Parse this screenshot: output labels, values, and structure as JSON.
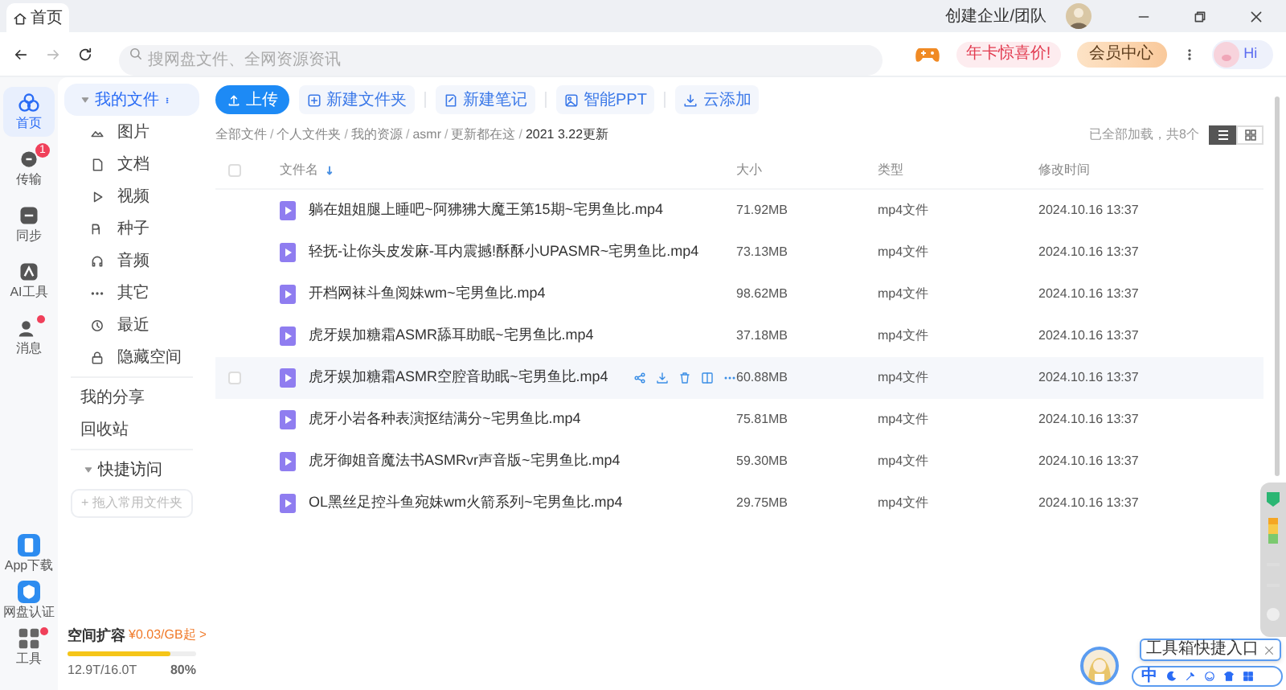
{
  "tab": {
    "label": "首页",
    "selected": true
  },
  "title_bar": {
    "team_link": "创建企业/团队"
  },
  "nav": {
    "search": {
      "placeholder": "搜网盘文件、全网资源资讯"
    },
    "promo": "年卡惊喜价!",
    "vip_button": "会员中心",
    "greeting": "Hi"
  },
  "rail": {
    "top": [
      {
        "label": "首页",
        "selected": true,
        "dot": false
      },
      {
        "label": "传输",
        "selected": false,
        "badge": "1",
        "dot": false
      },
      {
        "label": "同步",
        "selected": false,
        "dot": false
      },
      {
        "label": "AI工具",
        "selected": false,
        "dot": false
      },
      {
        "label": "消息",
        "selected": false,
        "dot": true
      }
    ],
    "bottom": [
      {
        "label": "App下载",
        "dot": false
      },
      {
        "label": "网盘认证",
        "dot": false
      },
      {
        "label": "工具",
        "dot": true
      }
    ]
  },
  "sidebar": {
    "my_files": {
      "label": "我的文件",
      "expanded": true,
      "selected": true,
      "children": [
        {
          "label": "图片"
        },
        {
          "label": "文档"
        },
        {
          "label": "视频"
        },
        {
          "label": "种子"
        },
        {
          "label": "音频"
        },
        {
          "label": "其它"
        }
      ]
    },
    "items": [
      {
        "label": "最近",
        "kind": "icon"
      },
      {
        "label": "隐藏空间",
        "kind": "icon"
      },
      {
        "label": "我的分享",
        "kind": "plain"
      },
      {
        "label": "回收站",
        "kind": "plain"
      }
    ],
    "quick_access": {
      "label": "快捷访问",
      "expanded": true,
      "drop_hint": "+ 拖入常用文件夹"
    },
    "storage": {
      "title": "空间扩容",
      "offer": "¥0.03/GB起 >",
      "level": 0.8,
      "usage": "12.9T/16.0T",
      "percent": "80%"
    }
  },
  "toolbar": {
    "upload": "上传",
    "actions": [
      "新建文件夹",
      "新建笔记",
      "智能PPT",
      "云添加"
    ]
  },
  "breadcrumb": {
    "separator": "/",
    "items": [
      "全部文件",
      "个人文件夹",
      "我的资源",
      "asmr",
      "更新都在这",
      "2021 3.22更新"
    ]
  },
  "status": "已全部加载，共8个",
  "view_mode": {
    "list_selected": true
  },
  "table": {
    "select_all": {
      "checked": false
    },
    "columns": [
      "文件名",
      "大小",
      "类型",
      "修改时间"
    ],
    "rows": [
      {
        "name": "躺在姐姐腿上睡吧~阿狒狒大魔王第15期~宅男鱼比.mp4",
        "size": "71.92MB",
        "type": "mp4文件",
        "time": "2024.10.16 13:37",
        "selected": false
      },
      {
        "name": "轻抚-让你头皮发麻-耳内震撼!酥酥小UPASMR~宅男鱼比.mp4",
        "size": "73.13MB",
        "type": "mp4文件",
        "time": "2024.10.16 13:37",
        "selected": false
      },
      {
        "name": "开档网袜斗鱼阅妹wm~宅男鱼比.mp4",
        "size": "98.62MB",
        "type": "mp4文件",
        "time": "2024.10.16 13:37",
        "selected": false
      },
      {
        "name": "虎牙娱加糖霜ASMR舔耳助眠~宅男鱼比.mp4",
        "size": "37.18MB",
        "type": "mp4文件",
        "time": "2024.10.16 13:37",
        "selected": false
      },
      {
        "name": "虎牙娱加糖霜ASMR空腔音助眠~宅男鱼比.mp4",
        "size": "60.88MB",
        "type": "mp4文件",
        "time": "2024.10.16 13:37",
        "selected": true
      },
      {
        "name": "虎牙小岩各种表演抠结满分~宅男鱼比.mp4",
        "size": "75.81MB",
        "type": "mp4文件",
        "time": "2024.10.16 13:37",
        "selected": false
      },
      {
        "name": "虎牙御姐音魔法书ASMRvr声音版~宅男鱼比.mp4",
        "size": "59.30MB",
        "type": "mp4文件",
        "time": "2024.10.16 13:37",
        "selected": false
      },
      {
        "name": "OL黑丝足控斗鱼宛妹wm火箭系列~宅男鱼比.mp4",
        "size": "29.75MB",
        "type": "mp4文件",
        "time": "2024.10.16 13:37",
        "selected": false
      }
    ]
  },
  "assistant": {
    "tooltip": "工具箱快捷入口",
    "ime_label": "中"
  }
}
